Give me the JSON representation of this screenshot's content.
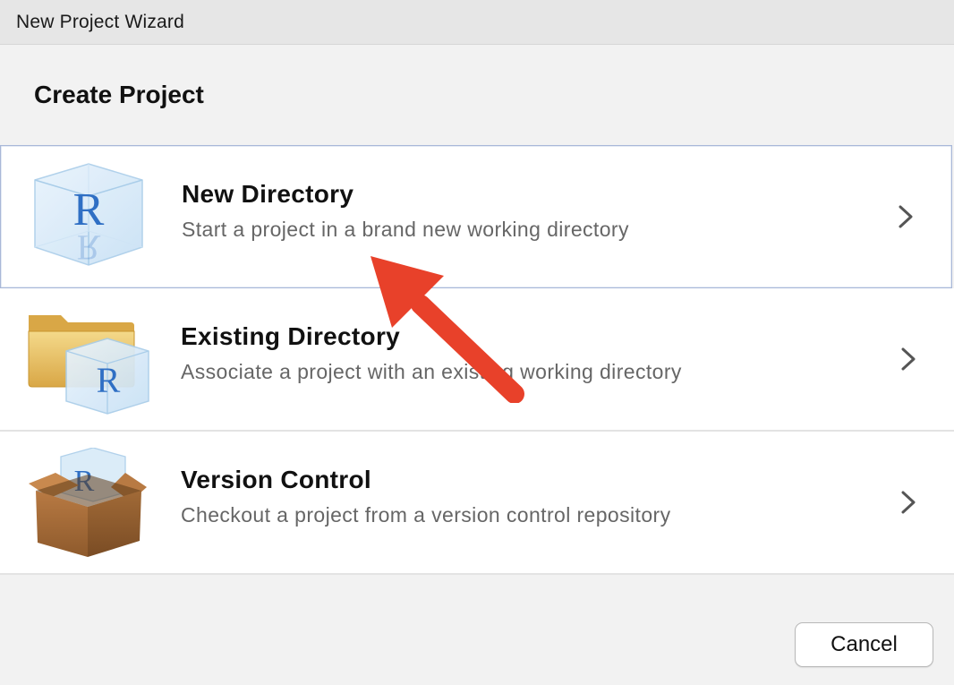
{
  "window": {
    "title": "New Project Wizard"
  },
  "dialog": {
    "heading": "Create Project",
    "options": [
      {
        "title": "New Directory",
        "description": "Start a project in a brand new working directory",
        "icon": "r-cube-icon",
        "selected": true
      },
      {
        "title": "Existing Directory",
        "description": "Associate a project with an existing working directory",
        "icon": "folder-r-cube-icon",
        "selected": false
      },
      {
        "title": "Version Control",
        "description": "Checkout a project from a version control repository",
        "icon": "box-r-cube-icon",
        "selected": false
      }
    ],
    "cancel_label": "Cancel"
  },
  "annotation": {
    "icon": "red-arrow-icon",
    "color": "#e8412a"
  },
  "colors": {
    "selection_border": "#a9b8d8",
    "r_blue": "#2f6fc4"
  }
}
